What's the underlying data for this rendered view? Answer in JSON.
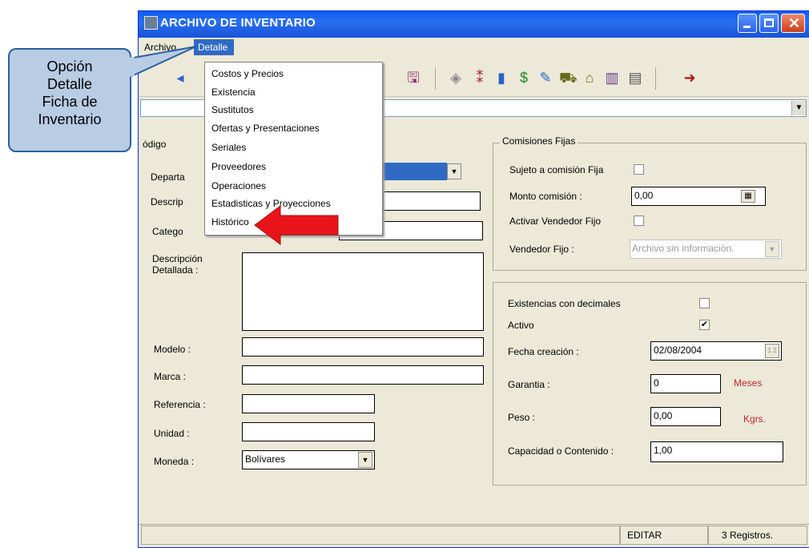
{
  "window": {
    "title": "ARCHIVO DE INVENTARIO"
  },
  "menubar": {
    "items": [
      "Archivo",
      "Detalle"
    ]
  },
  "detalle_menu": {
    "items": [
      "Costos y Precios",
      "Existencia",
      "Sustitutos",
      "Ofertas y Presentaciones",
      "Seriales",
      "Proveedores",
      "Operaciones",
      "Estadisticas y Proyecciones",
      "Histórico"
    ]
  },
  "callout": {
    "line1": "Opción",
    "line2": "Detalle",
    "line3": "Ficha de",
    "line4": "Inventario"
  },
  "form": {
    "codigo_label": "ódigo",
    "departamento_label": "Departa",
    "descripcion_label": "Descrip",
    "categoria_label": "Catego",
    "desc_detallada_label_1": "Descripción",
    "desc_detallada_label_2": "Detallada :",
    "modelo_label": "Modelo :",
    "marca_label": "Marca :",
    "referencia_label": "Referencia :",
    "unidad_label": "Unidad :",
    "moneda_label": "Moneda :",
    "moneda_value": "Bolívares"
  },
  "comisiones": {
    "title": "Comisiones Fijas",
    "sujeto_label": "Sujeto a comisión Fija",
    "monto_label": "Monto comisión :",
    "monto_value": "0,00",
    "activar_label": "Activar Vendedor Fijo",
    "vendedor_label": "Vendedor Fijo :",
    "vendedor_value": "Archivo sin información."
  },
  "extra": {
    "existencias_label": "Existencias con decimales",
    "activo_label": "Activo",
    "activo_checked": "✔",
    "fecha_label": "Fecha creación :",
    "fecha_value": "02/08/2004",
    "fecha_btn": "1 2",
    "garantia_label": "Garantia :",
    "garantia_value": "0",
    "garantia_unit": "Meses",
    "peso_label": "Peso :",
    "peso_value": "0,00",
    "peso_unit": "Kgrs.",
    "capacidad_label": "Capacidad o Contenido :",
    "capacidad_value": "1,00"
  },
  "status": {
    "mode": "EDITAR",
    "records": "3 Registros."
  },
  "colors": {
    "titlebar": "#0a5bf0",
    "accent_red": "#c0272d",
    "callout_fill": "#b8cce4"
  }
}
